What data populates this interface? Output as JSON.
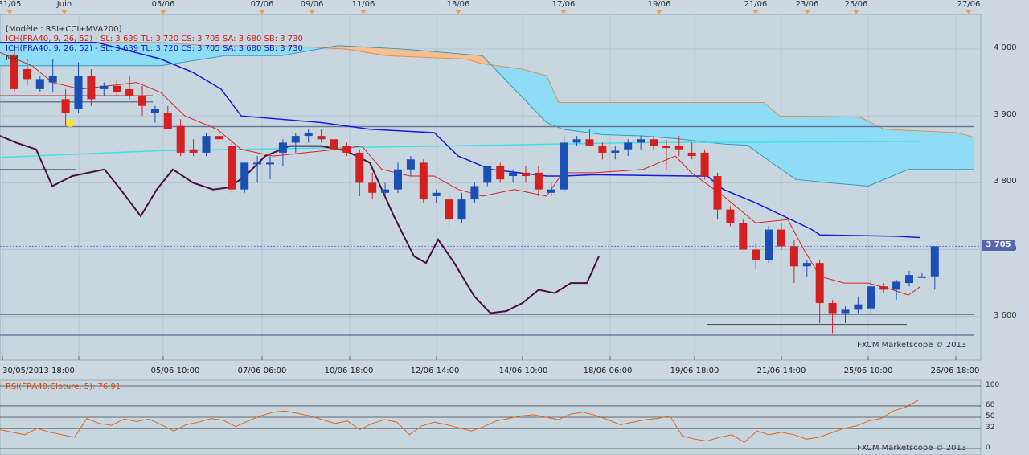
{
  "header_dates": [
    "31/05",
    "Juin",
    "05/06",
    "07/06",
    "09/06",
    "11/06",
    "13/06",
    "17/06",
    "19/06",
    "21/06",
    "23/06",
    "25/06",
    "27/06"
  ],
  "legend": {
    "model": "[Modèle : RSI+CCI+MVA200]",
    "ich_red": "ICH(FRA40, 9, 26, 52) -  SL: 3 639  TL: 3 720  CS: 3 705  SA: 3 680  SB: 3 730",
    "ich_blue": "ICH(FRA40, 9, 26, 52) -  SL: 3 639  TL: 3 720  CS: 3 705  SA: 3 680  SB: 3 730",
    "mva": "MV"
  },
  "price_axis": {
    "ticks": [
      "4 000",
      "3 900",
      "3 800",
      "3 700",
      "3 600"
    ],
    "current": "3 705"
  },
  "bottom_dates": [
    "30/05/2013 18:00",
    "05/06 10:00",
    "07/06 06:00",
    "10/06 18:00",
    "12/06 14:00",
    "14/06 10:00",
    "18/06 06:00",
    "19/06 18:00",
    "21/06 14:00",
    "25/06 10:00",
    "26/06 18:00"
  ],
  "credit_main": "FXCM Marketscope © 2013",
  "credit_rsi": "FXCM Marketscope © 2013",
  "rsi": {
    "label": "RSI(FRA40.Cloture, 5): 76,91",
    "levels": [
      "100",
      "68",
      "50",
      "32",
      "0"
    ],
    "value": 76.91
  },
  "colors": {
    "bull": "#1a4fb5",
    "bear": "#d42020",
    "kijun": "#1a1adc",
    "tenkan": "#e02020",
    "chikou": "#4a1040",
    "ma": "#40e0e8",
    "cloud_bear": "#f8c090",
    "cloud_bull": "#8fdcf6",
    "rsi_line": "#e06820"
  },
  "chart_data": {
    "type": "candlestick",
    "ylim": [
      3545,
      4030
    ],
    "candles": [
      {
        "o": 3990,
        "h": 4000,
        "l": 3935,
        "c": 3940
      },
      {
        "o": 3970,
        "h": 3985,
        "l": 3945,
        "c": 3955
      },
      {
        "o": 3940,
        "h": 3960,
        "l": 3935,
        "c": 3955
      },
      {
        "o": 3950,
        "h": 3985,
        "l": 3935,
        "c": 3960
      },
      {
        "o": 3925,
        "h": 3940,
        "l": 3885,
        "c": 3905
      },
      {
        "o": 3910,
        "h": 3980,
        "l": 3905,
        "c": 3960
      },
      {
        "o": 3960,
        "h": 3970,
        "l": 3915,
        "c": 3925
      },
      {
        "o": 3940,
        "h": 3950,
        "l": 3930,
        "c": 3945
      },
      {
        "o": 3945,
        "h": 3955,
        "l": 3930,
        "c": 3935
      },
      {
        "o": 3940,
        "h": 3960,
        "l": 3925,
        "c": 3930
      },
      {
        "o": 3930,
        "h": 3945,
        "l": 3900,
        "c": 3915
      },
      {
        "o": 3905,
        "h": 3915,
        "l": 3890,
        "c": 3910
      },
      {
        "o": 3905,
        "h": 3915,
        "l": 3885,
        "c": 3880
      },
      {
        "o": 3885,
        "h": 3895,
        "l": 3840,
        "c": 3845
      },
      {
        "o": 3850,
        "h": 3865,
        "l": 3840,
        "c": 3845
      },
      {
        "o": 3845,
        "h": 3875,
        "l": 3840,
        "c": 3870
      },
      {
        "o": 3870,
        "h": 3880,
        "l": 3860,
        "c": 3865
      },
      {
        "o": 3855,
        "h": 3865,
        "l": 3785,
        "c": 3790
      },
      {
        "o": 3790,
        "h": 3830,
        "l": 3785,
        "c": 3830
      },
      {
        "o": 3830,
        "h": 3840,
        "l": 3800,
        "c": 3830
      },
      {
        "o": 3830,
        "h": 3840,
        "l": 3805,
        "c": 3830
      },
      {
        "o": 3845,
        "h": 3865,
        "l": 3825,
        "c": 3860
      },
      {
        "o": 3860,
        "h": 3875,
        "l": 3845,
        "c": 3870
      },
      {
        "o": 3870,
        "h": 3880,
        "l": 3860,
        "c": 3875
      },
      {
        "o": 3870,
        "h": 3880,
        "l": 3860,
        "c": 3865
      },
      {
        "o": 3865,
        "h": 3890,
        "l": 3850,
        "c": 3850
      },
      {
        "o": 3855,
        "h": 3860,
        "l": 3840,
        "c": 3845
      },
      {
        "o": 3845,
        "h": 3850,
        "l": 3780,
        "c": 3800
      },
      {
        "o": 3800,
        "h": 3815,
        "l": 3775,
        "c": 3785
      },
      {
        "o": 3785,
        "h": 3800,
        "l": 3780,
        "c": 3790
      },
      {
        "o": 3790,
        "h": 3830,
        "l": 3785,
        "c": 3820
      },
      {
        "o": 3820,
        "h": 3840,
        "l": 3810,
        "c": 3835
      },
      {
        "o": 3830,
        "h": 3835,
        "l": 3770,
        "c": 3775
      },
      {
        "o": 3780,
        "h": 3790,
        "l": 3770,
        "c": 3785
      },
      {
        "o": 3775,
        "h": 3780,
        "l": 3730,
        "c": 3745
      },
      {
        "o": 3745,
        "h": 3785,
        "l": 3740,
        "c": 3775
      },
      {
        "o": 3775,
        "h": 3800,
        "l": 3770,
        "c": 3795
      },
      {
        "o": 3800,
        "h": 3825,
        "l": 3795,
        "c": 3825
      },
      {
        "o": 3825,
        "h": 3830,
        "l": 3800,
        "c": 3805
      },
      {
        "o": 3810,
        "h": 3820,
        "l": 3800,
        "c": 3815
      },
      {
        "o": 3815,
        "h": 3825,
        "l": 3800,
        "c": 3810
      },
      {
        "o": 3815,
        "h": 3825,
        "l": 3780,
        "c": 3790
      },
      {
        "o": 3785,
        "h": 3800,
        "l": 3780,
        "c": 3790
      },
      {
        "o": 3790,
        "h": 3870,
        "l": 3785,
        "c": 3860
      },
      {
        "o": 3860,
        "h": 3870,
        "l": 3855,
        "c": 3865
      },
      {
        "o": 3865,
        "h": 3880,
        "l": 3855,
        "c": 3855
      },
      {
        "o": 3855,
        "h": 3860,
        "l": 3835,
        "c": 3845
      },
      {
        "o": 3845,
        "h": 3855,
        "l": 3835,
        "c": 3848
      },
      {
        "o": 3850,
        "h": 3865,
        "l": 3840,
        "c": 3860
      },
      {
        "o": 3860,
        "h": 3870,
        "l": 3850,
        "c": 3865
      },
      {
        "o": 3865,
        "h": 3870,
        "l": 3850,
        "c": 3855
      },
      {
        "o": 3855,
        "h": 3865,
        "l": 3820,
        "c": 3852
      },
      {
        "o": 3855,
        "h": 3870,
        "l": 3840,
        "c": 3850
      },
      {
        "o": 3845,
        "h": 3860,
        "l": 3835,
        "c": 3840
      },
      {
        "o": 3845,
        "h": 3850,
        "l": 3805,
        "c": 3810
      },
      {
        "o": 3810,
        "h": 3815,
        "l": 3745,
        "c": 3760
      },
      {
        "o": 3760,
        "h": 3765,
        "l": 3735,
        "c": 3740
      },
      {
        "o": 3740,
        "h": 3745,
        "l": 3700,
        "c": 3700
      },
      {
        "o": 3700,
        "h": 3710,
        "l": 3670,
        "c": 3685
      },
      {
        "o": 3685,
        "h": 3735,
        "l": 3680,
        "c": 3730
      },
      {
        "o": 3730,
        "h": 3740,
        "l": 3700,
        "c": 3705
      },
      {
        "o": 3705,
        "h": 3715,
        "l": 3650,
        "c": 3675
      },
      {
        "o": 3675,
        "h": 3685,
        "l": 3660,
        "c": 3680
      },
      {
        "o": 3680,
        "h": 3685,
        "l": 3590,
        "c": 3620
      },
      {
        "o": 3620,
        "h": 3625,
        "l": 3575,
        "c": 3605
      },
      {
        "o": 3605,
        "h": 3615,
        "l": 3590,
        "c": 3610
      },
      {
        "o": 3610,
        "h": 3630,
        "l": 3605,
        "c": 3618
      },
      {
        "o": 3612,
        "h": 3655,
        "l": 3605,
        "c": 3645
      },
      {
        "o": 3645,
        "h": 3650,
        "l": 3635,
        "c": 3640
      },
      {
        "o": 3640,
        "h": 3655,
        "l": 3625,
        "c": 3652
      },
      {
        "o": 3650,
        "h": 3668,
        "l": 3645,
        "c": 3662
      },
      {
        "o": 3660,
        "h": 3665,
        "l": 3658,
        "c": 3660
      },
      {
        "o": 3660,
        "h": 3705,
        "l": 3640,
        "c": 3705
      }
    ],
    "hlines": [
      3930,
      3921,
      3884,
      3820,
      3603,
      3572
    ],
    "current_price": 3705,
    "kijun": [
      [
        0,
        4010
      ],
      [
        80,
        4010
      ],
      [
        120,
        4010
      ],
      [
        200,
        3985
      ],
      [
        240,
        3965
      ],
      [
        275,
        3940
      ],
      [
        300,
        3900
      ],
      [
        400,
        3890
      ],
      [
        460,
        3880
      ],
      [
        540,
        3875
      ],
      [
        570,
        3840
      ],
      [
        610,
        3820
      ],
      [
        680,
        3810
      ],
      [
        700,
        3810
      ],
      [
        740,
        3812
      ],
      [
        860,
        3810
      ],
      [
        880,
        3810
      ],
      [
        900,
        3790
      ],
      [
        940,
        3770
      ],
      [
        1010,
        3730
      ],
      [
        1020,
        3722
      ],
      [
        1115,
        3720
      ],
      [
        1145,
        3718
      ]
    ],
    "tenkan": [
      [
        0,
        3995
      ],
      [
        40,
        3975
      ],
      [
        65,
        3950
      ],
      [
        100,
        3940
      ],
      [
        170,
        3950
      ],
      [
        200,
        3935
      ],
      [
        230,
        3900
      ],
      [
        270,
        3880
      ],
      [
        300,
        3850
      ],
      [
        340,
        3840
      ],
      [
        380,
        3845
      ],
      [
        420,
        3850
      ],
      [
        450,
        3855
      ],
      [
        475,
        3820
      ],
      [
        510,
        3810
      ],
      [
        540,
        3810
      ],
      [
        570,
        3790
      ],
      [
        600,
        3780
      ],
      [
        640,
        3790
      ],
      [
        680,
        3780
      ],
      [
        700,
        3815
      ],
      [
        740,
        3815
      ],
      [
        800,
        3820
      ],
      [
        840,
        3840
      ],
      [
        860,
        3815
      ],
      [
        900,
        3780
      ],
      [
        940,
        3740
      ],
      [
        980,
        3745
      ],
      [
        1000,
        3700
      ],
      [
        1020,
        3660
      ],
      [
        1050,
        3650
      ],
      [
        1080,
        3650
      ],
      [
        1110,
        3640
      ],
      [
        1130,
        3632
      ],
      [
        1145,
        3645
      ]
    ],
    "chikou": [
      [
        0,
        3870
      ],
      [
        20,
        3860
      ],
      [
        45,
        3850
      ],
      [
        65,
        3795
      ],
      [
        90,
        3810
      ],
      [
        130,
        3820
      ],
      [
        150,
        3790
      ],
      [
        175,
        3750
      ],
      [
        195,
        3790
      ],
      [
        215,
        3820
      ],
      [
        240,
        3800
      ],
      [
        265,
        3790
      ],
      [
        285,
        3793
      ],
      [
        305,
        3810
      ],
      [
        330,
        3840
      ],
      [
        360,
        3855
      ],
      [
        400,
        3855
      ],
      [
        430,
        3848
      ],
      [
        460,
        3830
      ],
      [
        490,
        3750
      ],
      [
        515,
        3690
      ],
      [
        530,
        3680
      ],
      [
        545,
        3715
      ],
      [
        565,
        3680
      ],
      [
        590,
        3630
      ],
      [
        610,
        3605
      ],
      [
        630,
        3608
      ],
      [
        650,
        3620
      ],
      [
        670,
        3640
      ],
      [
        690,
        3635
      ],
      [
        710,
        3650
      ],
      [
        730,
        3650
      ],
      [
        745,
        3690
      ]
    ],
    "ma": [
      [
        0,
        3838
      ],
      [
        200,
        3848
      ],
      [
        400,
        3852
      ],
      [
        600,
        3856
      ],
      [
        800,
        3860
      ],
      [
        1000,
        3861
      ],
      [
        1145,
        3862
      ]
    ],
    "senkou_a": [
      [
        0,
        4010
      ],
      [
        130,
        4010
      ],
      [
        200,
        4010
      ],
      [
        260,
        4005
      ],
      [
        350,
        4005
      ],
      [
        430,
        4000
      ],
      [
        480,
        3990
      ],
      [
        580,
        3985
      ],
      [
        600,
        3978
      ],
      [
        650,
        3970
      ],
      [
        680,
        3960
      ],
      [
        695,
        3920
      ],
      [
        730,
        3920
      ],
      [
        800,
        3920
      ],
      [
        860,
        3920
      ],
      [
        900,
        3920
      ],
      [
        950,
        3920
      ],
      [
        970,
        3900
      ],
      [
        1070,
        3898
      ],
      [
        1100,
        3880
      ],
      [
        1190,
        3875
      ],
      [
        1212,
        3868
      ]
    ],
    "senkou_b": [
      [
        0,
        3975
      ],
      [
        100,
        3975
      ],
      [
        200,
        3975
      ],
      [
        280,
        3990
      ],
      [
        350,
        3990
      ],
      [
        420,
        4005
      ],
      [
        500,
        4000
      ],
      [
        600,
        3990
      ],
      [
        680,
        3890
      ],
      [
        700,
        3880
      ],
      [
        750,
        3872
      ],
      [
        800,
        3870
      ],
      [
        840,
        3866
      ],
      [
        900,
        3858
      ],
      [
        930,
        3856
      ],
      [
        960,
        3830
      ],
      [
        990,
        3805
      ],
      [
        1030,
        3800
      ],
      [
        1080,
        3795
      ],
      [
        1110,
        3810
      ],
      [
        1130,
        3820
      ],
      [
        1212,
        3820
      ]
    ],
    "rsi_series": [
      30,
      26,
      22,
      32,
      26,
      22,
      18,
      48,
      40,
      37,
      47,
      43,
      47,
      38,
      28,
      38,
      42,
      48,
      45,
      35,
      44,
      52,
      58,
      60,
      56,
      52,
      46,
      40,
      44,
      30,
      40,
      46,
      42,
      22,
      36,
      42,
      38,
      33,
      28,
      35,
      44,
      48,
      52,
      54,
      50,
      46,
      55,
      58,
      53,
      46,
      38,
      42,
      46,
      48,
      52,
      20,
      15,
      12,
      18,
      22,
      10,
      28,
      22,
      26,
      22,
      15,
      18,
      25,
      32,
      36,
      44,
      48,
      60,
      66,
      76.91
    ]
  }
}
